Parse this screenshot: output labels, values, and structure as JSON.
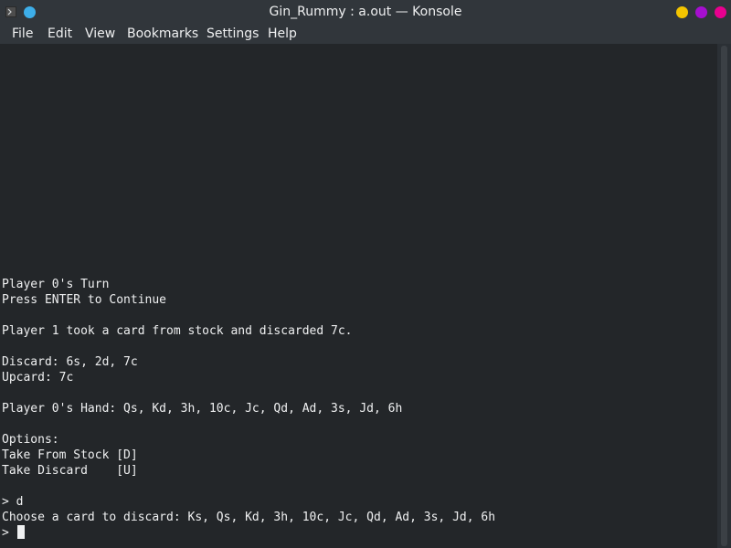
{
  "window": {
    "title": "Gin_Rummy : a.out — Konsole"
  },
  "menu": {
    "items": [
      "File",
      "Edit",
      "View",
      "Bookmarks",
      "Settings",
      "Help"
    ]
  },
  "terminal": {
    "lines": [
      "Player 0's Turn",
      "Press ENTER to Continue",
      "",
      "Player 1 took a card from stock and discarded 7c.",
      "",
      "Discard: 6s, 2d, 7c",
      "Upcard: 7c",
      "",
      "Player 0's Hand: Qs, Kd, 3h, 10c, Jc, Qd, Ad, 3s, Jd, 6h",
      "",
      "Options:",
      "Take From Stock [D]",
      "Take Discard    [U]",
      "",
      "> d",
      "Choose a card to discard: Ks, Qs, Kd, 3h, 10c, Jc, Qd, Ad, 3s, Jd, 6h"
    ],
    "prompt": "> "
  },
  "colors": {
    "chrome_bg": "#31363b",
    "terminal_bg": "#232629",
    "text": "#eff0f1",
    "minimize": "#f4c500",
    "maximize": "#a60fd0",
    "close": "#e8008f",
    "accent": "#3daee9"
  }
}
